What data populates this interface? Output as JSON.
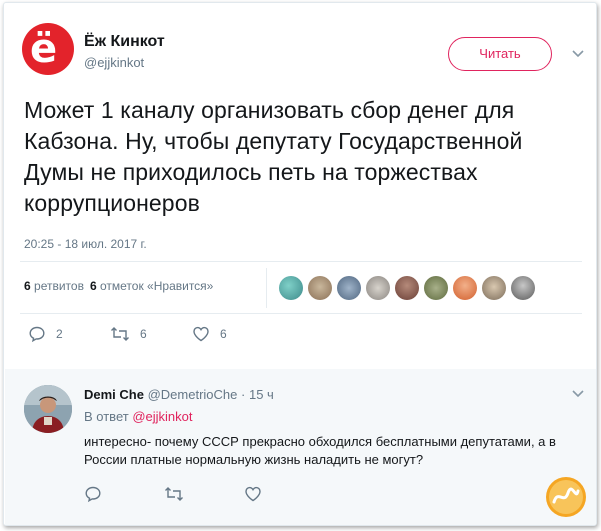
{
  "tweet": {
    "author_name": "Ёж Кинкот",
    "author_handle": "@ejjkinkot",
    "follow_label": "Читать",
    "text": "Может 1 каналу организовать сбор денег для Кабзона. Ну, чтобы депутату Государственной Думы не приходилось петь на торжествах коррупционеров",
    "timestamp": "20:25 - 18 июл. 2017 г.",
    "retweets_count": "6",
    "retweets_label": "ретвитов",
    "likes_count": "6",
    "likes_label": "отметок «Нравится»",
    "actions": {
      "reply_count": "2",
      "retweet_count": "6",
      "like_count": "6"
    }
  },
  "reply": {
    "author_name": "Demi Che",
    "author_handle": "@DemetrioChe",
    "dot": "·",
    "time": "15 ч",
    "in_reply_prefix": "В ответ",
    "in_reply_handle": "@ejjkinkot",
    "text": "интересно- почему СССР прекрасно обходился бесплатными депутатами, а в России платные нормальную жизнь наладить не могут?"
  },
  "avatar_logo_text": "ё",
  "colors": {
    "accent": "#e0245e",
    "brand_red": "#e3232b",
    "muted": "#657786",
    "text": "#14171a"
  }
}
